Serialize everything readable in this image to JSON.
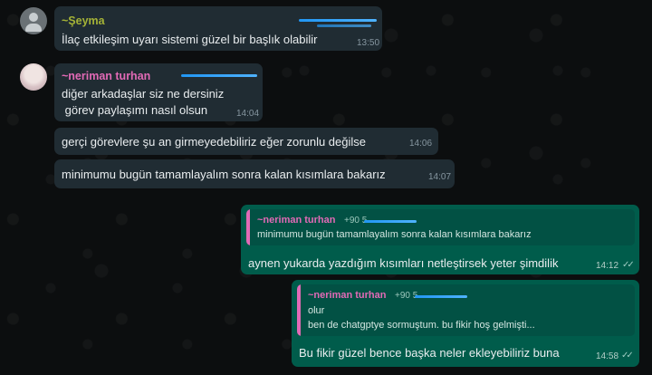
{
  "messages": [
    {
      "sender": "~Şeyma",
      "text": "İlaç etkileşim uyarı sistemi güzel bir başlık olabilir",
      "time": "13:50"
    },
    {
      "sender": "~neriman turhan",
      "text_line1": "diğer arkadaşlar siz ne dersiniz",
      "text_line2": " görev paylaşımı nasıl olsun",
      "time": "14:04"
    },
    {
      "text": "gerçi görevlere şu an girmeyedebiliriz eğer zorunlu değilse",
      "time": "14:06"
    },
    {
      "text": "minimumu bugün tamamlayalım sonra kalan kısımlara bakarız",
      "time": "14:07"
    }
  ],
  "replies": [
    {
      "quote_sender": "~neriman turhan",
      "quote_phone": "+90 5",
      "quote_text": "minimumu bugün tamamlayalım sonra kalan kısımlara bakarız",
      "text": "aynen yukarda yazdığım kısımları netleştirsek yeter şimdilik",
      "time": "14:12"
    },
    {
      "quote_sender": "~neriman turhan",
      "quote_phone": "+90 5",
      "quote_line1": "olur",
      "quote_line2": "ben de chatgptye sormuştum. bu fikir hoş gelmişti...",
      "text": "Bu fikir güzel bence başka neler ekleyebiliriz buna",
      "time": "14:58"
    }
  ],
  "icons": {
    "read_ticks": "double-check-icon"
  },
  "colors": {
    "incoming": "#202c33",
    "outgoing": "#005c4b",
    "sender_seyma": "#a5b337",
    "sender_neriman": "#e26ab6"
  }
}
